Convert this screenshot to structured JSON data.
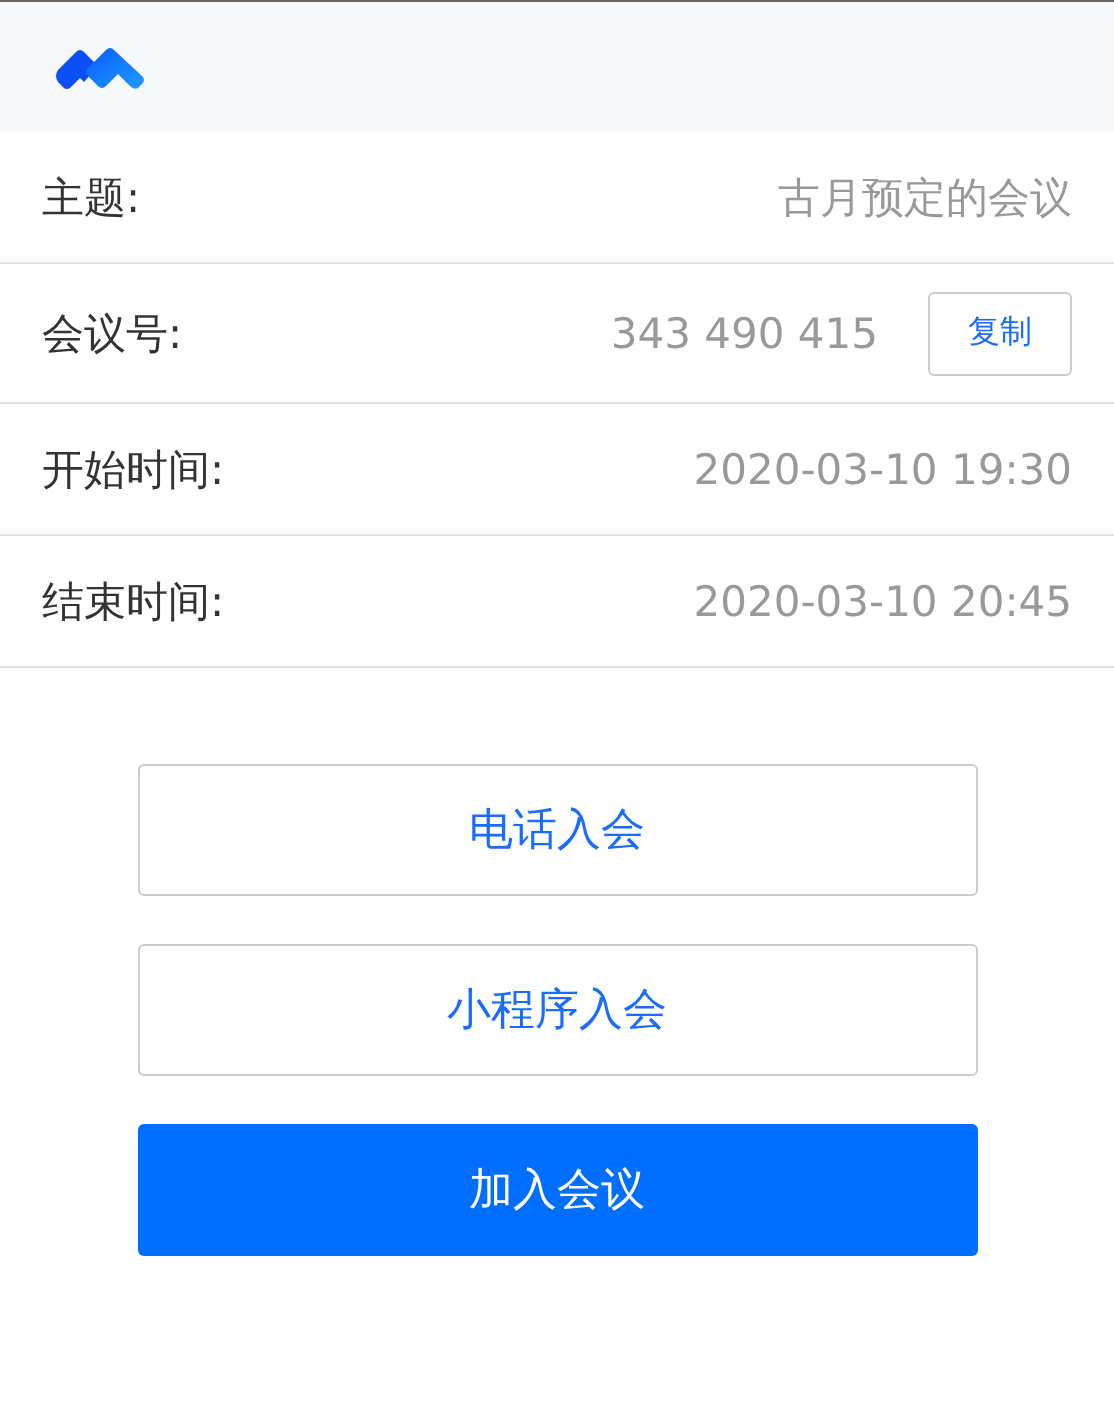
{
  "details": [
    {
      "label": "主题:",
      "value": "古月预定的会议"
    },
    {
      "label": "会议号:",
      "value": "343 490 415",
      "action": "复制"
    },
    {
      "label": "开始时间:",
      "value": "2020-03-10 19:30"
    },
    {
      "label": "结束时间:",
      "value": "2020-03-10 20:45"
    }
  ],
  "buttons": [
    {
      "label": "电话入会",
      "kind": "outline"
    },
    {
      "label": "小程序入会",
      "kind": "outline"
    },
    {
      "label": "加入会议",
      "kind": "primary"
    }
  ]
}
